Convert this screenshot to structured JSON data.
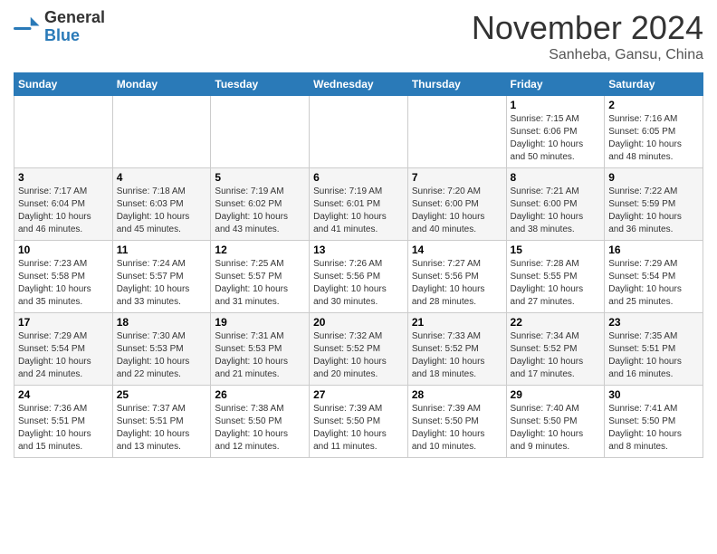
{
  "header": {
    "logo_line1": "General",
    "logo_line2": "Blue",
    "month": "November 2024",
    "location": "Sanheba, Gansu, China"
  },
  "weekdays": [
    "Sunday",
    "Monday",
    "Tuesday",
    "Wednesday",
    "Thursday",
    "Friday",
    "Saturday"
  ],
  "weeks": [
    [
      {
        "day": "",
        "info": ""
      },
      {
        "day": "",
        "info": ""
      },
      {
        "day": "",
        "info": ""
      },
      {
        "day": "",
        "info": ""
      },
      {
        "day": "",
        "info": ""
      },
      {
        "day": "1",
        "info": "Sunrise: 7:15 AM\nSunset: 6:06 PM\nDaylight: 10 hours\nand 50 minutes."
      },
      {
        "day": "2",
        "info": "Sunrise: 7:16 AM\nSunset: 6:05 PM\nDaylight: 10 hours\nand 48 minutes."
      }
    ],
    [
      {
        "day": "3",
        "info": "Sunrise: 7:17 AM\nSunset: 6:04 PM\nDaylight: 10 hours\nand 46 minutes."
      },
      {
        "day": "4",
        "info": "Sunrise: 7:18 AM\nSunset: 6:03 PM\nDaylight: 10 hours\nand 45 minutes."
      },
      {
        "day": "5",
        "info": "Sunrise: 7:19 AM\nSunset: 6:02 PM\nDaylight: 10 hours\nand 43 minutes."
      },
      {
        "day": "6",
        "info": "Sunrise: 7:19 AM\nSunset: 6:01 PM\nDaylight: 10 hours\nand 41 minutes."
      },
      {
        "day": "7",
        "info": "Sunrise: 7:20 AM\nSunset: 6:00 PM\nDaylight: 10 hours\nand 40 minutes."
      },
      {
        "day": "8",
        "info": "Sunrise: 7:21 AM\nSunset: 6:00 PM\nDaylight: 10 hours\nand 38 minutes."
      },
      {
        "day": "9",
        "info": "Sunrise: 7:22 AM\nSunset: 5:59 PM\nDaylight: 10 hours\nand 36 minutes."
      }
    ],
    [
      {
        "day": "10",
        "info": "Sunrise: 7:23 AM\nSunset: 5:58 PM\nDaylight: 10 hours\nand 35 minutes."
      },
      {
        "day": "11",
        "info": "Sunrise: 7:24 AM\nSunset: 5:57 PM\nDaylight: 10 hours\nand 33 minutes."
      },
      {
        "day": "12",
        "info": "Sunrise: 7:25 AM\nSunset: 5:57 PM\nDaylight: 10 hours\nand 31 minutes."
      },
      {
        "day": "13",
        "info": "Sunrise: 7:26 AM\nSunset: 5:56 PM\nDaylight: 10 hours\nand 30 minutes."
      },
      {
        "day": "14",
        "info": "Sunrise: 7:27 AM\nSunset: 5:56 PM\nDaylight: 10 hours\nand 28 minutes."
      },
      {
        "day": "15",
        "info": "Sunrise: 7:28 AM\nSunset: 5:55 PM\nDaylight: 10 hours\nand 27 minutes."
      },
      {
        "day": "16",
        "info": "Sunrise: 7:29 AM\nSunset: 5:54 PM\nDaylight: 10 hours\nand 25 minutes."
      }
    ],
    [
      {
        "day": "17",
        "info": "Sunrise: 7:29 AM\nSunset: 5:54 PM\nDaylight: 10 hours\nand 24 minutes."
      },
      {
        "day": "18",
        "info": "Sunrise: 7:30 AM\nSunset: 5:53 PM\nDaylight: 10 hours\nand 22 minutes."
      },
      {
        "day": "19",
        "info": "Sunrise: 7:31 AM\nSunset: 5:53 PM\nDaylight: 10 hours\nand 21 minutes."
      },
      {
        "day": "20",
        "info": "Sunrise: 7:32 AM\nSunset: 5:52 PM\nDaylight: 10 hours\nand 20 minutes."
      },
      {
        "day": "21",
        "info": "Sunrise: 7:33 AM\nSunset: 5:52 PM\nDaylight: 10 hours\nand 18 minutes."
      },
      {
        "day": "22",
        "info": "Sunrise: 7:34 AM\nSunset: 5:52 PM\nDaylight: 10 hours\nand 17 minutes."
      },
      {
        "day": "23",
        "info": "Sunrise: 7:35 AM\nSunset: 5:51 PM\nDaylight: 10 hours\nand 16 minutes."
      }
    ],
    [
      {
        "day": "24",
        "info": "Sunrise: 7:36 AM\nSunset: 5:51 PM\nDaylight: 10 hours\nand 15 minutes."
      },
      {
        "day": "25",
        "info": "Sunrise: 7:37 AM\nSunset: 5:51 PM\nDaylight: 10 hours\nand 13 minutes."
      },
      {
        "day": "26",
        "info": "Sunrise: 7:38 AM\nSunset: 5:50 PM\nDaylight: 10 hours\nand 12 minutes."
      },
      {
        "day": "27",
        "info": "Sunrise: 7:39 AM\nSunset: 5:50 PM\nDaylight: 10 hours\nand 11 minutes."
      },
      {
        "day": "28",
        "info": "Sunrise: 7:39 AM\nSunset: 5:50 PM\nDaylight: 10 hours\nand 10 minutes."
      },
      {
        "day": "29",
        "info": "Sunrise: 7:40 AM\nSunset: 5:50 PM\nDaylight: 10 hours\nand 9 minutes."
      },
      {
        "day": "30",
        "info": "Sunrise: 7:41 AM\nSunset: 5:50 PM\nDaylight: 10 hours\nand 8 minutes."
      }
    ]
  ]
}
